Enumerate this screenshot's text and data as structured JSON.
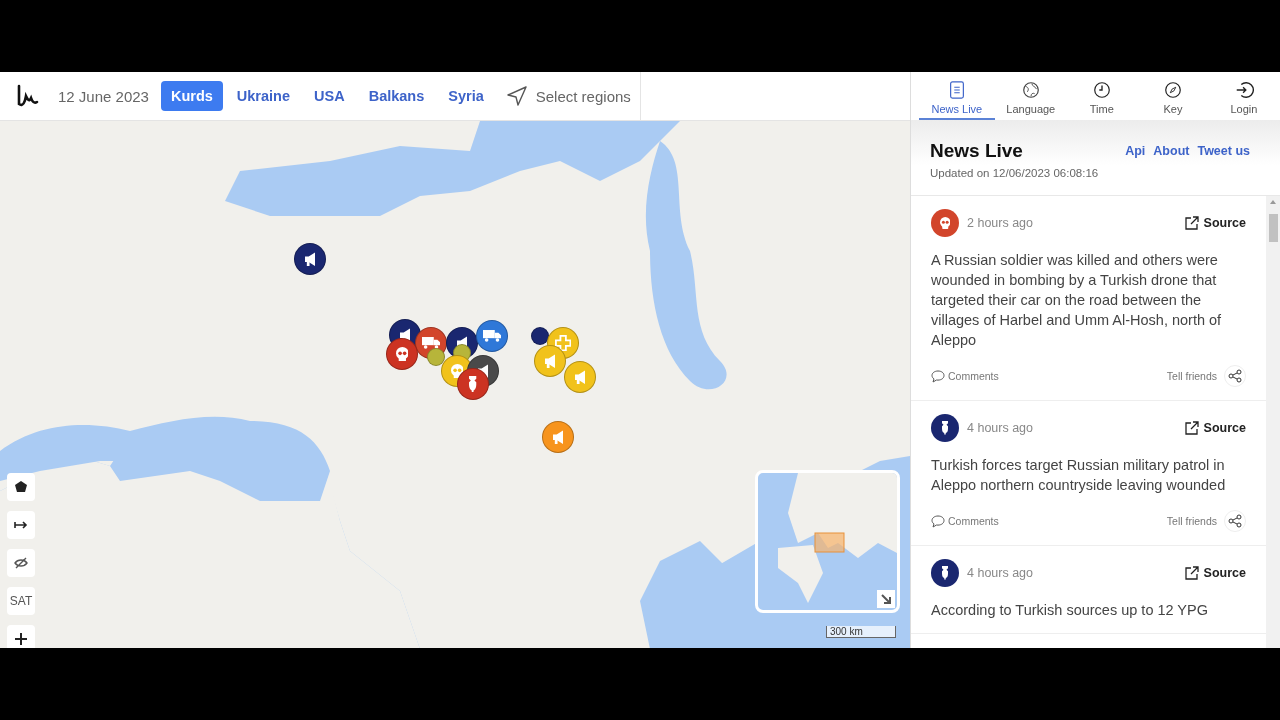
{
  "header": {
    "date": "12 June 2023",
    "select_regions": "Select regions",
    "regions": [
      {
        "label": "Kurds",
        "selected": true
      },
      {
        "label": "Ukraine",
        "selected": false
      },
      {
        "label": "USA",
        "selected": false
      },
      {
        "label": "Balkans",
        "selected": false
      },
      {
        "label": "Syria",
        "selected": false
      }
    ]
  },
  "map": {
    "scale": "300 km",
    "markers": [
      {
        "kind": "megaphone",
        "color": "#1a2770"
      },
      {
        "kind": "megaphone",
        "color": "#1a2770"
      },
      {
        "kind": "truck",
        "color": "#d2452b"
      },
      {
        "kind": "skull",
        "color": "#cc3322"
      },
      {
        "kind": "megaphone",
        "color": "#1a2770"
      },
      {
        "kind": "truck",
        "color": "#2f78d8"
      },
      {
        "kind": "dot",
        "color": "#b7b53a"
      },
      {
        "kind": "dot",
        "color": "#b7b53a"
      },
      {
        "kind": "skull",
        "color": "#f1c21b"
      },
      {
        "kind": "megaphone",
        "color": "#4a4a4a"
      },
      {
        "kind": "bomb",
        "color": "#cc3322"
      },
      {
        "kind": "dot",
        "color": "#1a2770"
      },
      {
        "kind": "plus",
        "color": "#f1c21b"
      },
      {
        "kind": "megaphone",
        "color": "#f1c21b"
      },
      {
        "kind": "megaphone",
        "color": "#f1c21b"
      },
      {
        "kind": "megaphone",
        "color": "#f7941d"
      }
    ],
    "controls": [
      {
        "kind": "polygon"
      },
      {
        "kind": "arrow"
      },
      {
        "kind": "eye-off"
      },
      {
        "kind": "text",
        "label": "SAT"
      },
      {
        "kind": "zoom-in"
      }
    ]
  },
  "nav_tabs": [
    {
      "label": "News Live",
      "kind": "news",
      "selected": true
    },
    {
      "label": "Language",
      "kind": "globe",
      "selected": false
    },
    {
      "label": "Time",
      "kind": "clock",
      "selected": false
    },
    {
      "label": "Key",
      "kind": "compass",
      "selected": false
    },
    {
      "label": "Login",
      "kind": "login",
      "selected": false
    }
  ],
  "panel": {
    "title": "News Live",
    "links": [
      "Api",
      "About",
      "Tweet us"
    ],
    "updated": "Updated on 12/06/2023 06:08:16"
  },
  "news": [
    {
      "kind": "skull",
      "color": "#d2452b",
      "time": "2 hours ago",
      "source": "Source",
      "text": "A Russian soldier was killed and others were wounded in bombing by a Turkish drone that targeted their car on the road between the villages of Harbel and Umm Al-Hosh, north of Aleppo",
      "comments": "Comments",
      "tell_friends": "Tell friends"
    },
    {
      "kind": "bomb",
      "color": "#1a2770",
      "time": "4 hours ago",
      "source": "Source",
      "text": "Turkish forces target Russian military patrol in Aleppo northern countryside leaving wounded",
      "comments": "Comments",
      "tell_friends": "Tell friends"
    },
    {
      "kind": "bomb",
      "color": "#1a2770",
      "time": "4 hours ago",
      "source": "Source",
      "text": "According to Turkish sources up to 12 YPG"
    }
  ]
}
